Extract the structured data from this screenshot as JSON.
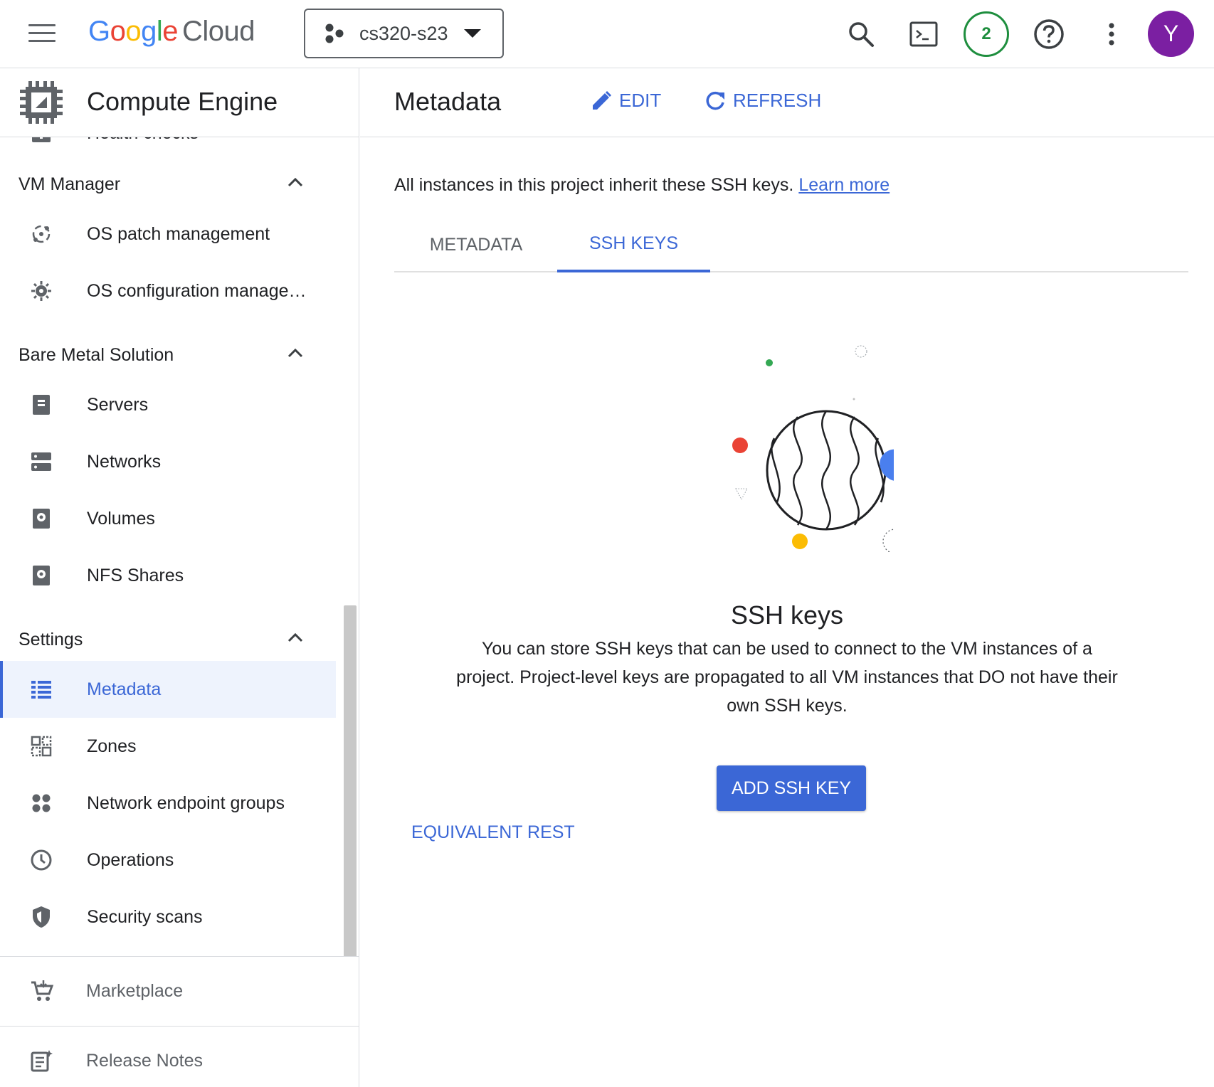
{
  "topbar": {
    "logo_letters": [
      "G",
      "o",
      "o",
      "g",
      "l",
      "e"
    ],
    "logo_product": "Cloud",
    "project_name": "cs320-s23",
    "notifications_count": "2",
    "avatar_initial": "Y"
  },
  "sidebar": {
    "product_title": "Compute Engine",
    "partial_item": "Health checks",
    "sections": {
      "vm_manager": "VM Manager",
      "bare_metal": "Bare Metal Solution",
      "settings": "Settings"
    },
    "items": {
      "os_patch": "OS patch management",
      "os_config": "OS configuration manage…",
      "servers": "Servers",
      "networks": "Networks",
      "volumes": "Volumes",
      "nfs_shares": "NFS Shares",
      "metadata": "Metadata",
      "zones": "Zones",
      "neg": "Network endpoint groups",
      "operations": "Operations",
      "security_scans": "Security scans"
    },
    "footer": {
      "marketplace": "Marketplace",
      "release_notes": "Release Notes"
    }
  },
  "main": {
    "title": "Metadata",
    "edit_label": "EDIT",
    "refresh_label": "REFRESH",
    "info_text": "All instances in this project inherit these SSH keys.",
    "learn_more": "Learn more",
    "tabs": [
      "METADATA",
      "SSH KEYS"
    ],
    "active_tab": "SSH KEYS",
    "empty_title": "SSH keys",
    "empty_description": "You can store SSH keys that can be used to connect to the VM instances of a project. Project-level keys are propagated to all VM instances that DO not have their own SSH keys.",
    "add_button": "ADD SSH KEY",
    "equivalent_rest": "EQUIVALENT REST"
  },
  "colors": {
    "accent": "#3b67d6",
    "avatar_bg": "#7b1fa2",
    "notification_ring": "#1e8e3e",
    "active_item_bg": "#eef3fd"
  }
}
